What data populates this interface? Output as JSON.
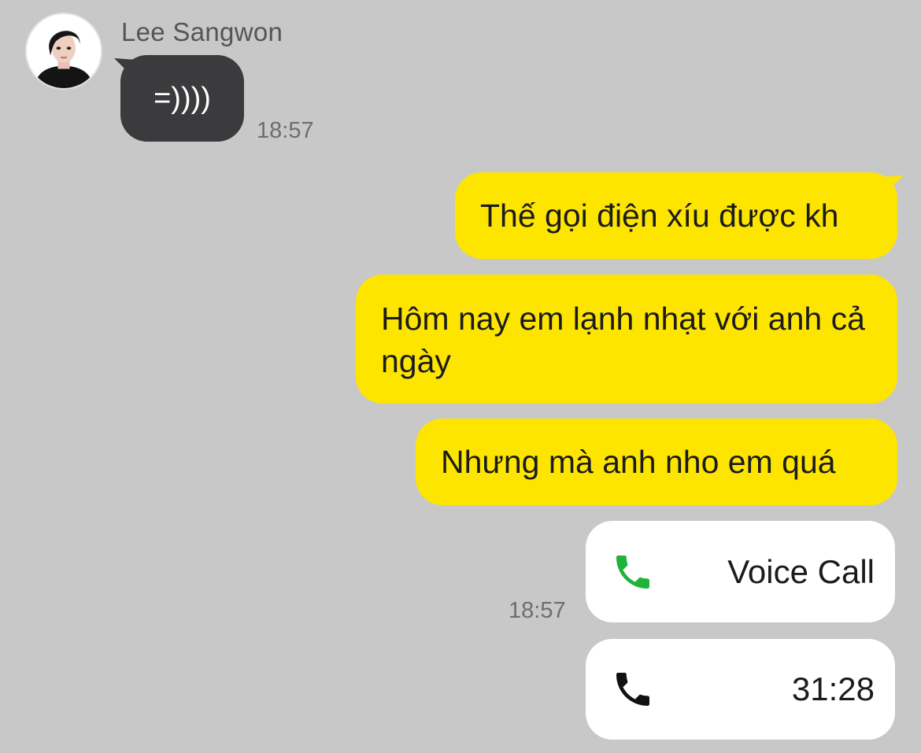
{
  "incoming": {
    "sender_name": "Lee Sangwon",
    "message": "=))))",
    "time": "18:57"
  },
  "outgoing": {
    "messages": [
      "Thế gọi điện xíu được kh",
      "Hôm nay em lạnh nhạt với anh cả ngày",
      "Nhưng mà anh nho em quá"
    ],
    "time": "18:57",
    "calls": [
      {
        "icon": "phone-icon",
        "label": "Voice Call",
        "icon_color": "#1fb33a"
      },
      {
        "icon": "phone-icon",
        "label": "31:28",
        "icon_color": "#111111"
      }
    ]
  },
  "colors": {
    "background": "#c8c8c8",
    "incoming_bubble": "#3b3b3d",
    "outgoing_bubble": "#fee500",
    "call_bubble": "#ffffff"
  }
}
